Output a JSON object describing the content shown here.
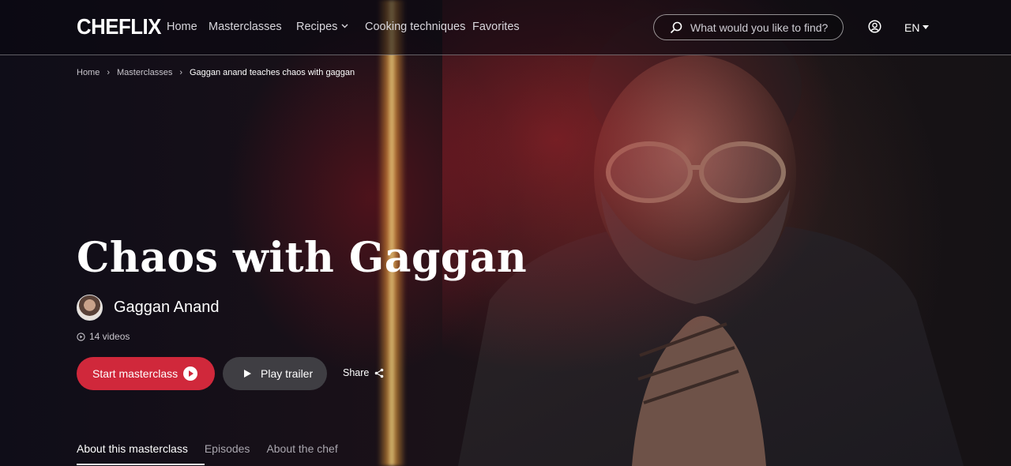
{
  "brand": {
    "logo": "CHEFLIX"
  },
  "nav": {
    "items": [
      {
        "label": "Home"
      },
      {
        "label": "Masterclasses"
      },
      {
        "label": "Recipes"
      },
      {
        "label": "Cooking techniques"
      },
      {
        "label": "Favorites"
      }
    ]
  },
  "search": {
    "placeholder": "What would you like to find?"
  },
  "language": {
    "current": "EN"
  },
  "breadcrumb": [
    {
      "label": "Home"
    },
    {
      "label": "Masterclasses"
    },
    {
      "label": "Gaggan anand teaches chaos with gaggan"
    }
  ],
  "hero": {
    "title": "Chaos with Gaggan",
    "chef_name": "Gaggan Anand",
    "video_count": "14 videos",
    "start_label": "Start masterclass",
    "trailer_label": "Play trailer",
    "share_label": "Share"
  },
  "tabs": [
    {
      "label": "About this masterclass",
      "active": true
    },
    {
      "label": "Episodes",
      "active": false
    },
    {
      "label": "About the chef",
      "active": false
    }
  ],
  "colors": {
    "accent": "#d0283b",
    "background": "#14121a"
  }
}
